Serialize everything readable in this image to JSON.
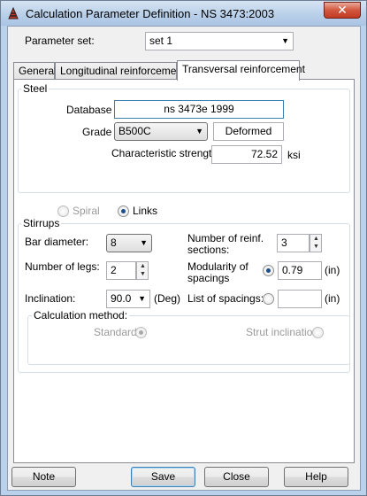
{
  "window": {
    "title": "Calculation Parameter Definition - NS 3473:2003",
    "close_glyph": "✕"
  },
  "parameter_set": {
    "label": "Parameter set:",
    "value": "set 1"
  },
  "tabs": [
    {
      "label": "General"
    },
    {
      "label": "Longitudinal reinforcement"
    },
    {
      "label": "Transversal reinforcement"
    }
  ],
  "steel": {
    "title": "Steel",
    "database_label": "Database",
    "database_value": "ns 3473e 1999",
    "grade_label": "Grade",
    "grade_value": "B500C",
    "deformed_label": "Deformed",
    "char_strength_label": "Characteristic strength",
    "char_strength_value": "72.52",
    "char_strength_unit": "ksi"
  },
  "type": {
    "spiral_label": "Spiral",
    "links_label": "Links"
  },
  "stirrups": {
    "title": "Stirrups",
    "bar_diameter_label": "Bar diameter:",
    "bar_diameter_value": "8",
    "num_sections_label_1": "Number of reinf.",
    "num_sections_label_2": "sections:",
    "num_sections_value": "3",
    "num_legs_label": "Number of legs:",
    "num_legs_value": "2",
    "modularity_label_1": "Modularity of",
    "modularity_label_2": "spacings",
    "modularity_value": "0.79",
    "modularity_unit": "(in)",
    "inclination_label": "Inclination:",
    "inclination_value": "90.0",
    "inclination_unit": "(Deg)",
    "list_spacings_label": "List of spacings:",
    "list_spacings_value": "",
    "list_spacings_unit": "(in)"
  },
  "calc_method": {
    "title": "Calculation method:",
    "standard_label": "Standard",
    "strut_label": "Strut inclination"
  },
  "buttons": {
    "note": "Note",
    "save": "Save",
    "close": "Close",
    "help": "Help"
  },
  "colors": {
    "title_bar": "#bcd2ea",
    "close_button": "#c23a22",
    "focus_border": "#3c7fb1"
  }
}
